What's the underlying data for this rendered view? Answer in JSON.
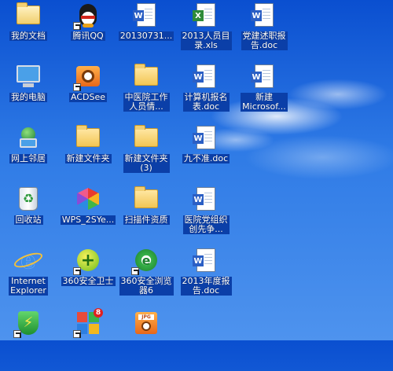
{
  "desktop": {
    "icons": [
      {
        "label": "我的文档",
        "icon": "my-documents-icon"
      },
      {
        "label": "腾讯QQ",
        "icon": "qq-penguin-icon"
      },
      {
        "label": "20130731...",
        "icon": "word-document-icon"
      },
      {
        "label": "2013人员目\n录.xls",
        "icon": "excel-document-icon"
      },
      {
        "label": "党建述职报\n告.doc",
        "icon": "word-document-icon"
      },
      {
        "label": "我的电脑",
        "icon": "my-computer-icon"
      },
      {
        "label": "ACDSee",
        "icon": "acdsee-icon"
      },
      {
        "label": "中医院工作\n人员情...",
        "icon": "folder-icon"
      },
      {
        "label": "计算机报名\n表.doc",
        "icon": "word-document-icon"
      },
      {
        "label": "新建\nMicrosof...",
        "icon": "word-document-icon"
      },
      {
        "label": "网上邻居",
        "icon": "network-places-icon"
      },
      {
        "label": "新建文件夹",
        "icon": "folder-icon"
      },
      {
        "label": "新建文件夹\n(3)",
        "icon": "folder-icon"
      },
      {
        "label": "九不准.doc",
        "icon": "word-document-icon"
      },
      {
        "label": "回收站",
        "icon": "recycle-bin-icon"
      },
      {
        "label": "WPS_2SYe...",
        "icon": "wps-icon"
      },
      {
        "label": "扫描件资质",
        "icon": "folder-icon"
      },
      {
        "label": "医院党组织\n创先争...",
        "icon": "word-document-icon"
      },
      {
        "label": "Internet\nExplorer",
        "icon": "internet-explorer-icon"
      },
      {
        "label": "360安全卫士",
        "icon": "360-safe-icon"
      },
      {
        "label": "360安全浏览\n器6",
        "icon": "360-browser-icon"
      },
      {
        "label": "2013年度报\n告.doc",
        "icon": "word-document-icon"
      },
      {
        "label": "",
        "icon": "360-shield-icon"
      },
      {
        "label": "",
        "icon": "360-software-manager-icon"
      },
      {
        "label": "",
        "icon": "jpg-image-icon"
      }
    ]
  }
}
